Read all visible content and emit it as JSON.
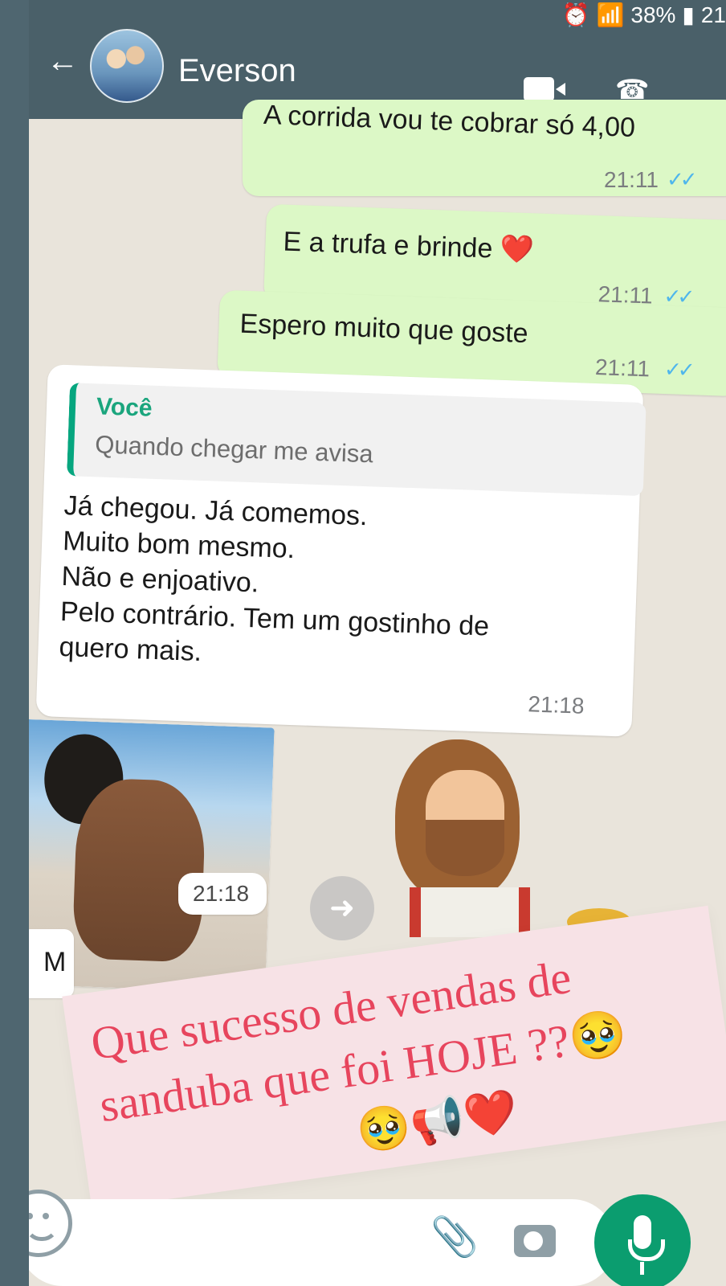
{
  "status_bar": {
    "battery": "38%",
    "time": "21"
  },
  "header": {
    "back_icon": "arrow-left-icon",
    "contact_name": "Everson",
    "video_icon": "video-icon",
    "call_icon": "phone-icon"
  },
  "messages": [
    {
      "type": "outgoing",
      "text": "A corrida vou te cobrar só 4,00",
      "time": "21:11",
      "status": "read"
    },
    {
      "type": "outgoing",
      "text": "E a trufa e brinde ❤️",
      "time": "21:11",
      "status": "read"
    },
    {
      "type": "outgoing",
      "text": "Espero muito que goste",
      "time": "21:11",
      "status": "read"
    },
    {
      "type": "incoming",
      "quote_author": "Você",
      "quote_text": "Quando chegar me avisa",
      "text_lines": [
        "Já chegou. Já comemos.",
        "Muito bom mesmo.",
        "Não e enjoativo.",
        "Pelo contrário. Tem um gostinho de",
        "quero mais."
      ],
      "time": "21:18"
    },
    {
      "type": "incoming-media",
      "time": "21:18"
    }
  ],
  "partial_message": {
    "text": "M"
  },
  "composer": {
    "emoji_icon": "emoji-icon",
    "attach_icon": "paperclip-icon",
    "camera_icon": "camera-icon",
    "mic_icon": "microphone-icon"
  },
  "caption_overlay": {
    "line1": "Que sucesso de vendas  de",
    "line2": "sanduba que foi HOJE ??🥹",
    "line3": "🥹📢❤️"
  },
  "colors": {
    "header": "#4a6069",
    "chat_background": "#e9e4db",
    "outgoing_bubble": "#dcf8c6",
    "incoming_bubble": "#ffffff",
    "accent": "#0b9d6f",
    "quote_accent": "#06a67f",
    "caption_text": "#e7455d",
    "caption_background": "#f7e2e6",
    "tick_blue": "#4fb6ec"
  }
}
